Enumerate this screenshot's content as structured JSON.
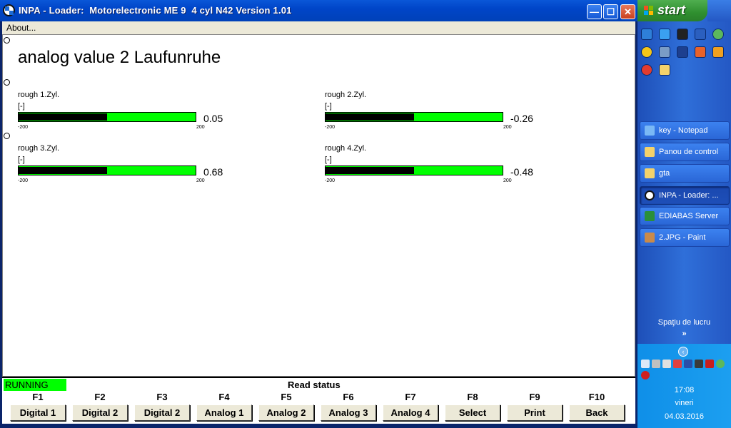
{
  "window": {
    "title": "INPA - Loader:  Motorelectronic ME 9  4 cyl N42 Version 1.01",
    "min_glyph": "—",
    "max_glyph": "☐",
    "close_glyph": "✕"
  },
  "menu": {
    "about": "About..."
  },
  "main": {
    "title": "analog value 2 Laufunruhe",
    "gauges": [
      {
        "label": "rough 1.Zyl.",
        "unit": "[-]",
        "value": "0.05",
        "min": "-200",
        "max": "200",
        "fill_fraction": 0.5
      },
      {
        "label": "rough 2.Zyl.",
        "unit": "[-]",
        "value": "-0.26",
        "min": "-200",
        "max": "200",
        "fill_fraction": 0.5
      },
      {
        "label": "rough 3.Zyl.",
        "unit": "[-]",
        "value": "0.68",
        "min": "-200",
        "max": "200",
        "fill_fraction": 0.5
      },
      {
        "label": "rough 4.Zyl.",
        "unit": "[-]",
        "value": "-0.48",
        "min": "-200",
        "max": "200",
        "fill_fraction": 0.5
      }
    ]
  },
  "status": {
    "running": "RUNNING",
    "text": "Read status"
  },
  "fkeys": [
    {
      "key": "F1",
      "label": "Digital 1"
    },
    {
      "key": "F2",
      "label": "Digital 2"
    },
    {
      "key": "F3",
      "label": "Digital 2"
    },
    {
      "key": "F4",
      "label": "Analog 1"
    },
    {
      "key": "F5",
      "label": "Analog 2"
    },
    {
      "key": "F6",
      "label": "Analog 3"
    },
    {
      "key": "F7",
      "label": "Analog 4"
    },
    {
      "key": "F8",
      "label": "Select"
    },
    {
      "key": "F9",
      "label": "Print"
    },
    {
      "key": "F10",
      "label": "Back"
    }
  ],
  "taskbar": {
    "start": "start",
    "tasks": [
      {
        "label": "key - Notepad",
        "icon": "notepad-icon",
        "color": "#7ab8f5"
      },
      {
        "label": "Panou de control",
        "icon": "folder-icon",
        "color": "#f3d26b"
      },
      {
        "label": "gta",
        "icon": "folder-icon",
        "color": "#f3d26b"
      },
      {
        "label": "INPA - Loader: ...",
        "icon": "bmw-icon",
        "color": "#ffffff",
        "active": true
      },
      {
        "label": "EDIABAS Server",
        "icon": "ediabas-icon",
        "color": "#2a8f3a"
      },
      {
        "label": "2.JPG - Paint",
        "icon": "paint-icon",
        "color": "#c98a4a"
      }
    ],
    "workspace": "Spaţiu de lucru",
    "workspace_chevron": "»",
    "clock_time": "17:08",
    "clock_day": "vineri",
    "clock_date": "04.03.2016"
  },
  "colors": {
    "gauge_bar": "#00ff00",
    "gauge_fill": "#000000",
    "running": "#00ff00",
    "title_bar": "#0041b8"
  }
}
